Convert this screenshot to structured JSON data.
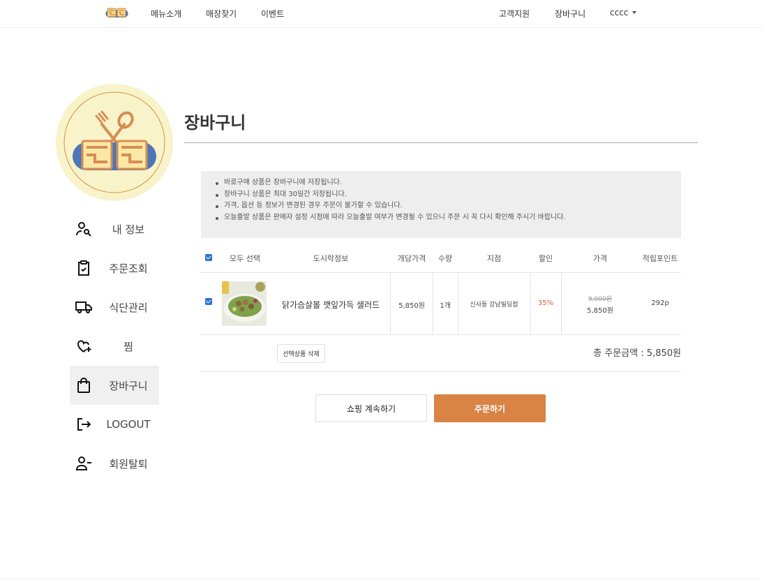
{
  "nav": {
    "left": [
      "메뉴소개",
      "매장찾기",
      "이벤트"
    ],
    "right": [
      "고객지원",
      "장바구니"
    ],
    "user": "cccc"
  },
  "sidebar": {
    "items": [
      {
        "label": "내 정보",
        "icon": "user-search-icon"
      },
      {
        "label": "주문조회",
        "icon": "clipboard-check-icon"
      },
      {
        "label": "식단관리",
        "icon": "truck-icon"
      },
      {
        "label": "찜",
        "icon": "heart-plus-icon"
      },
      {
        "label": "장바구니",
        "icon": "shopping-bag-icon"
      },
      {
        "label": "LOGOUT",
        "icon": "logout-icon"
      },
      {
        "label": "회원탈퇴",
        "icon": "user-remove-icon"
      }
    ]
  },
  "page": {
    "title": "장바구니"
  },
  "notice": {
    "items": [
      "바로구매 상품은 장바구니에 저장됩니다.",
      "장바구니 상품은 최대 30일간 저장됩니다.",
      "가격, 옵션 등 정보가 변경된 경우 주문이 불가할 수 있습니다.",
      "오늘출발 상품은 판매자 설정 시점에 따라 오늘출발 여부가 변경될 수 있으니 주문 시 꼭 다시 확인해 주시기 바랍니다."
    ]
  },
  "table": {
    "headers": {
      "select_all": "모두 선택",
      "info": "도시락정보",
      "unit_price": "개당가격",
      "qty": "수량",
      "branch": "지점",
      "discount": "할인",
      "price": "가격",
      "points": "적립포인트"
    },
    "rows": [
      {
        "name": "닭가슴살볼 깻잎가득 샐러드",
        "unit_price": "5,850원",
        "qty": "1개",
        "branch": "신사동 강남빌딩점",
        "discount": "35%",
        "original_price": "9,000원",
        "price": "5,850원",
        "points": "292p"
      }
    ]
  },
  "actions": {
    "delete_selected": "선택상품 삭제",
    "total": "총 주문금액 : 5,850원",
    "continue": "쇼핑 계속하기",
    "order": "주문하기"
  },
  "colors": {
    "accent": "#d98345",
    "discount": "#e05a3a",
    "checkbox": "#2f73d8",
    "logo_blue": "#4d76b8",
    "logo_cream": "#f8f3c8"
  }
}
